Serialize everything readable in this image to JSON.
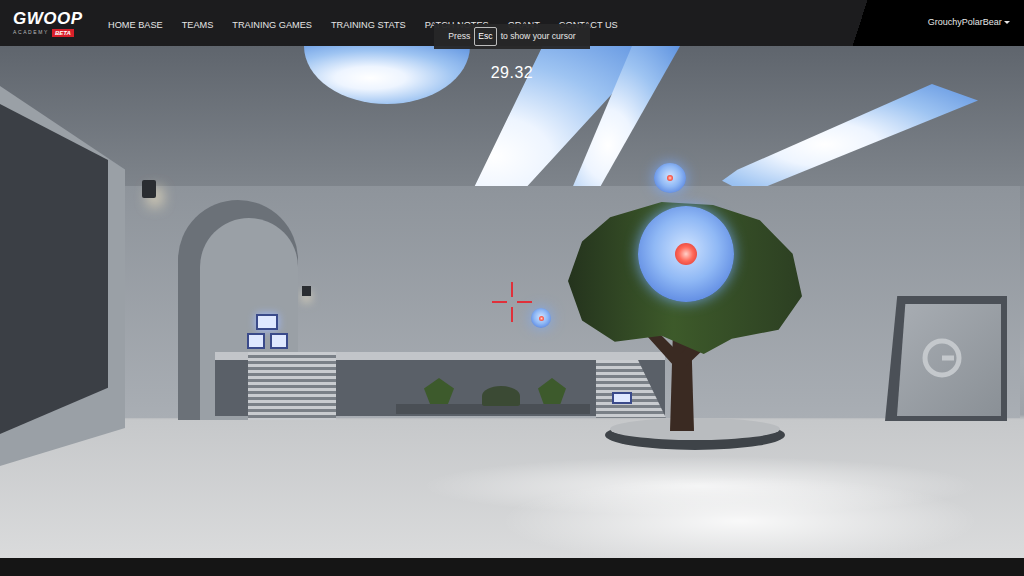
{
  "navbar": {
    "logo": {
      "text": "GWOOP",
      "subtitle": "ACADEMY",
      "badge": "BETA"
    },
    "items": [
      {
        "label": "HOME BASE"
      },
      {
        "label": "TEAMS"
      },
      {
        "label": "TRAINING GAMES"
      },
      {
        "label": "TRAINING STATS"
      },
      {
        "label": "PATCH NOTES"
      },
      {
        "label": "GRANT"
      },
      {
        "label": "CONTACT US"
      }
    ],
    "user": {
      "name": "GrouchyPolarBear"
    }
  },
  "hint": {
    "before": "Press",
    "key": "Esc",
    "after": "to show your cursor"
  },
  "game": {
    "timer": "29.32"
  }
}
